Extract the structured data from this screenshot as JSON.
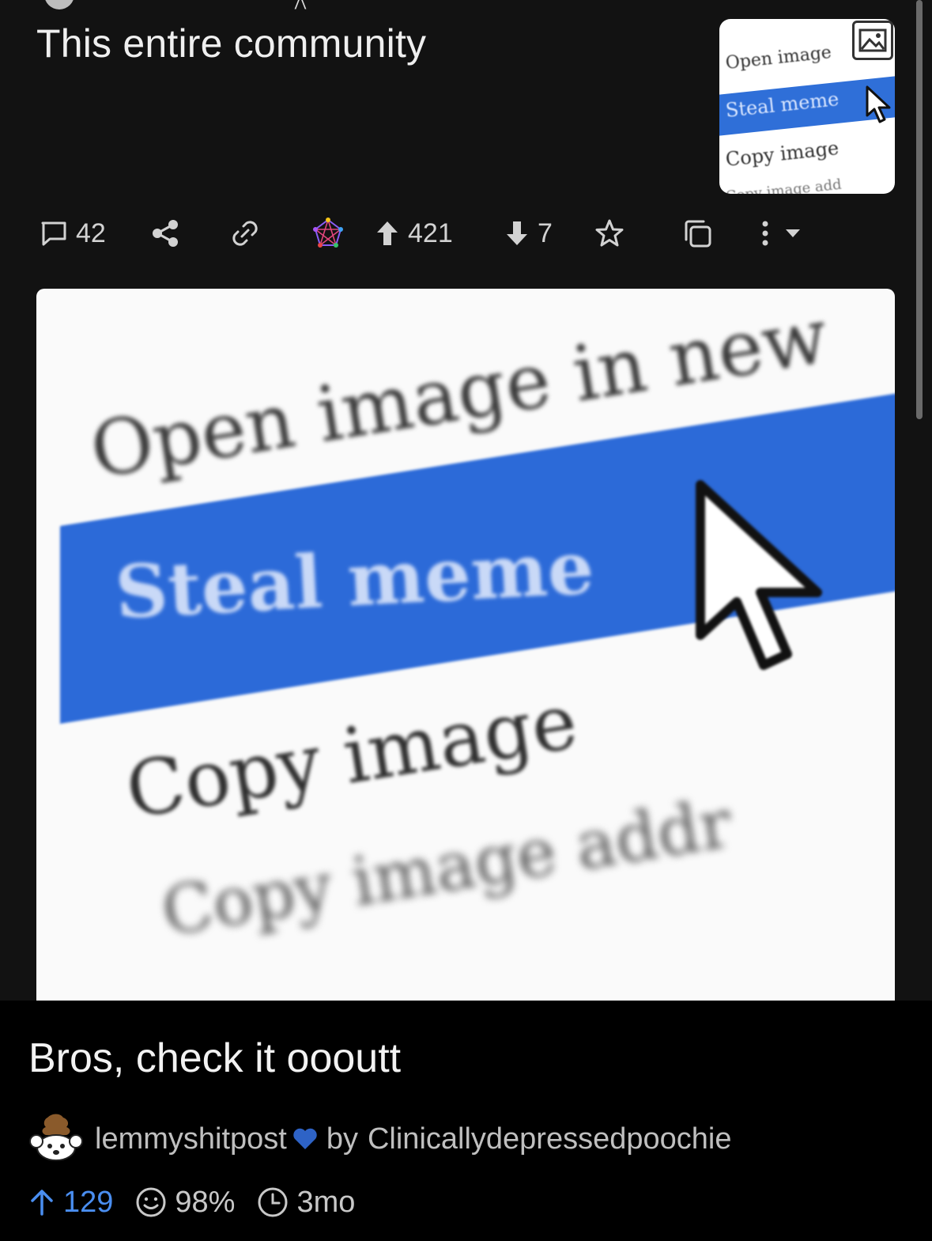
{
  "post": {
    "title": "This entire community",
    "body": "Bros, check it oooutt"
  },
  "thumbnail": {
    "lines": [
      "Open image",
      "Steal meme",
      "Copy image",
      "Copy image add"
    ],
    "icon": "image-icon"
  },
  "actions": {
    "comments_count": "42",
    "upvotes": "421",
    "downvotes": "7",
    "icons": [
      "comment-icon",
      "share-icon",
      "link-icon",
      "fediverse-icon",
      "upvote-icon",
      "downvote-icon",
      "star-icon",
      "copy-icon",
      "more-icon",
      "dropdown-icon"
    ]
  },
  "meme_image": {
    "lines": [
      "Open image in new",
      "Steal meme",
      "Copy image",
      "Copy image addr"
    ],
    "highlight_color": "#2c6ad8"
  },
  "meta": {
    "community": "lemmyshitpost",
    "by_prefix": "by",
    "author": "Clinicallydepressedpoochie",
    "heart_color": "#2e63c6"
  },
  "stats": {
    "score": "129",
    "ratio": "98%",
    "age": "3mo",
    "score_color": "#4a8ef0"
  }
}
